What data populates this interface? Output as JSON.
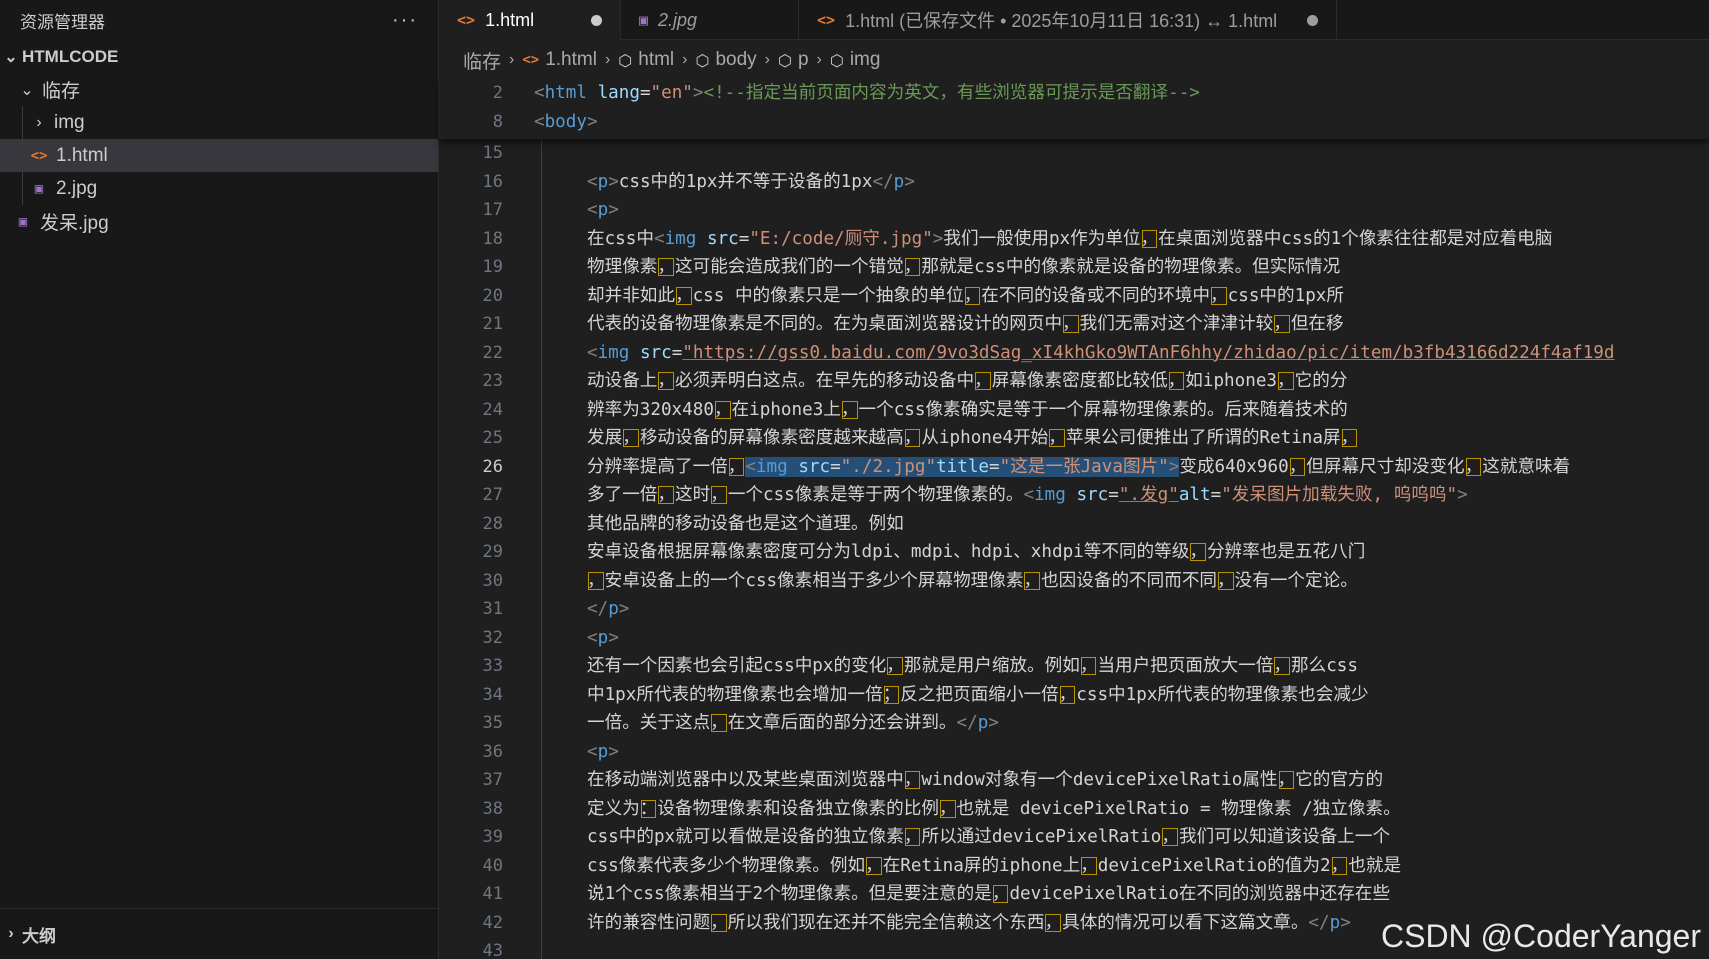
{
  "sidebar": {
    "title": "资源管理器",
    "more": "···",
    "root": "HTMLCODE",
    "folder": "临存",
    "items": [
      {
        "label": "img"
      },
      {
        "label": "1.html"
      },
      {
        "label": "2.jpg"
      },
      {
        "label": "发呆.jpg"
      }
    ],
    "outline": "大纲"
  },
  "tabs": [
    {
      "label": "1.html"
    },
    {
      "label": "2.jpg"
    },
    {
      "label": "1.html (已保存文件 • 2025年10月11日 16:31) ↔ 1.html"
    }
  ],
  "breadcrumb": [
    "临存",
    "1.html",
    "html",
    "body",
    "p",
    "img"
  ],
  "sticky": [
    {
      "num": "2",
      "text": "<html lang=\"en\"><!--指定当前页面内容为英文，有些浏览器可提示是否翻译-->"
    },
    {
      "num": "8",
      "text": "<body>"
    }
  ],
  "lines": [
    {
      "num": "15",
      "text": ""
    },
    {
      "num": "16",
      "text": "<p>css中的1px并不等于设备的1px</p>"
    },
    {
      "num": "17",
      "text": "<p>"
    },
    {
      "num": "18",
      "text": "在css中<img src=\"E:/code/厕守.jpg\">我们一般使用px作为单位，在桌面浏览器中css的1个像素往往都是对应着电脑"
    },
    {
      "num": "19",
      "text": "物理像素，这可能会造成我们的一个错觉，那就是css中的像素就是设备的物理像素。但实际情况"
    },
    {
      "num": "20",
      "text": "却并非如此，css 中的像素只是一个抽象的单位，在不同的设备或不同的环境中，css中的1px所"
    },
    {
      "num": "21",
      "text": "代表的设备物理像素是不同的。在为桌面浏览器设计的网页中，我们无需对这个津津计较，但在移"
    },
    {
      "num": "22",
      "text": "<img src=\"https://gss0.baidu.com/9vo3dSag_xI4khGko9WTAnF6hhy/zhidao/pic/item/b3fb43166d224f4af19d"
    },
    {
      "num": "23",
      "text": "动设备上，必须弄明白这点。在早先的移动设备中，屏幕像素密度都比较低，如iphone3，它的分"
    },
    {
      "num": "24",
      "text": "辨率为320x480，在iphone3上，一个css像素确实是等于一个屏幕物理像素的。后来随着技术的"
    },
    {
      "num": "25",
      "text": "发展，移动设备的屏幕像素密度越来越高，从iphone4开始，苹果公司便推出了所谓的Retina屏，"
    },
    {
      "num": "26",
      "text": "分辨率提高了一倍，<img src=\"./2.jpg\"title=\"这是一张Java图片\">变成640x960，但屏幕尺寸却没变化，这就意味着"
    },
    {
      "num": "27",
      "text": "多了一倍，这时，一个css像素是等于两个物理像素的。<img src=\".发g\"alt=\"发呆图片加载失败, 呜呜呜\">"
    },
    {
      "num": "28",
      "text": "其他品牌的移动设备也是这个道理。例如"
    },
    {
      "num": "29",
      "text": "安卓设备根据屏幕像素密度可分为ldpi、mdpi、hdpi、xhdpi等不同的等级，分辨率也是五花八门"
    },
    {
      "num": "30",
      "text": "，安卓设备上的一个css像素相当于多少个屏幕物理像素，也因设备的不同而不同，没有一个定论。"
    },
    {
      "num": "31",
      "text": "</p>"
    },
    {
      "num": "32",
      "text": "<p>"
    },
    {
      "num": "33",
      "text": "还有一个因素也会引起css中px的变化，那就是用户缩放。例如，当用户把页面放大一倍，那么css"
    },
    {
      "num": "34",
      "text": "中1px所代表的物理像素也会增加一倍；反之把页面缩小一倍，css中1px所代表的物理像素也会减少"
    },
    {
      "num": "35",
      "text": "一倍。关于这点，在文章后面的部分还会讲到。</p>"
    },
    {
      "num": "36",
      "text": "<p>"
    },
    {
      "num": "37",
      "text": "在移动端浏览器中以及某些桌面浏览器中，window对象有一个devicePixelRatio属性，它的官方的"
    },
    {
      "num": "38",
      "text": "定义为：设备物理像素和设备独立像素的比例，也就是 devicePixelRatio = 物理像素 /独立像素。"
    },
    {
      "num": "39",
      "text": "css中的px就可以看做是设备的独立像素，所以通过devicePixelRatio，我们可以知道该设备上一个"
    },
    {
      "num": "40",
      "text": "css像素代表多少个物理像素。例如，在Retina屏的iphone上，devicePixelRatio的值为2，也就是"
    },
    {
      "num": "41",
      "text": "说1个css像素相当于2个物理像素。但是要注意的是，devicePixelRatio在不同的浏览器中还存在些"
    },
    {
      "num": "42",
      "text": "许的兼容性问题，所以我们现在还并不能完全信赖这个东西，具体的情况可以看下这篇文章。</p>"
    },
    {
      "num": "43",
      "text": ""
    }
  ],
  "current_line": "26",
  "watermark": "CSDN @CoderYanger"
}
